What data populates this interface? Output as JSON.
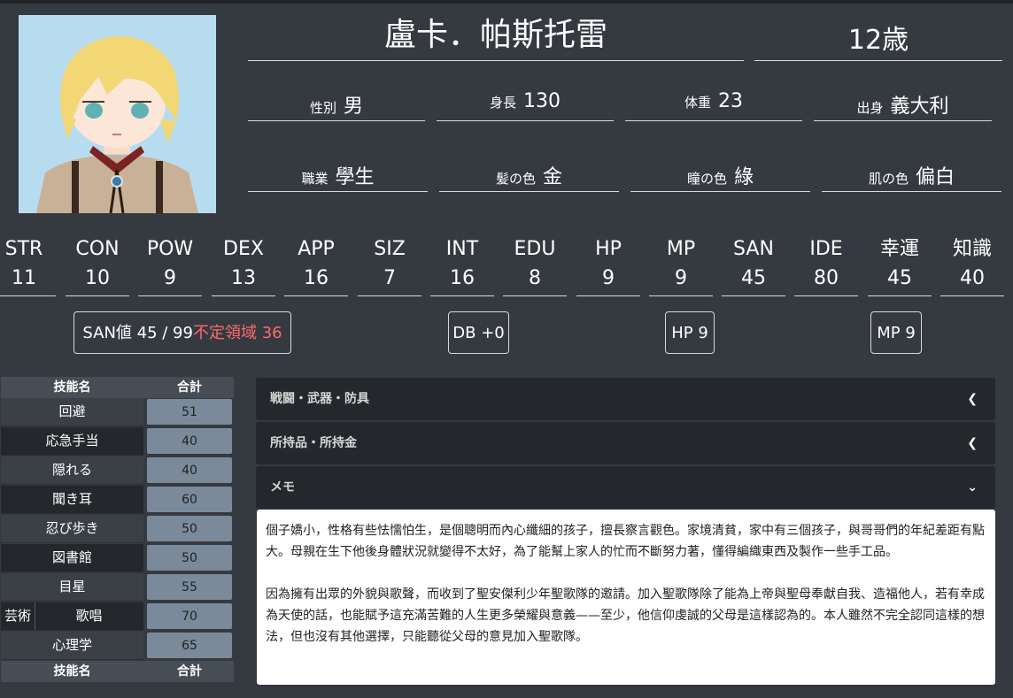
{
  "character": {
    "name": "盧卡．帕斯托雷",
    "age": "12歳"
  },
  "attributes": [
    {
      "label": "性別",
      "value": "男"
    },
    {
      "label": "身長",
      "value": "130"
    },
    {
      "label": "体重",
      "value": "23"
    },
    {
      "label": "出身",
      "value": "義大利"
    },
    {
      "label": "職業",
      "value": "學生"
    },
    {
      "label": "髪の色",
      "value": "金"
    },
    {
      "label": "瞳の色",
      "value": "綠"
    },
    {
      "label": "肌の色",
      "value": "偏白"
    }
  ],
  "stats": [
    {
      "label": "STR",
      "value": "11"
    },
    {
      "label": "CON",
      "value": "10"
    },
    {
      "label": "POW",
      "value": "9"
    },
    {
      "label": "DEX",
      "value": "13"
    },
    {
      "label": "APP",
      "value": "16"
    },
    {
      "label": "SIZ",
      "value": "7"
    },
    {
      "label": "INT",
      "value": "16"
    },
    {
      "label": "EDU",
      "value": "8"
    },
    {
      "label": "HP",
      "value": "9"
    },
    {
      "label": "MP",
      "value": "9"
    },
    {
      "label": "SAN",
      "value": "45"
    },
    {
      "label": "IDE",
      "value": "80"
    },
    {
      "label": "幸運",
      "value": "45"
    },
    {
      "label": "知識",
      "value": "40"
    }
  ],
  "badges": {
    "san": "SAN値 45 / 99",
    "san_warning": "不定領域 36",
    "db": "DB +0",
    "hp": "HP 9",
    "mp": "MP 9"
  },
  "skills": {
    "header_name": "技能名",
    "header_total": "合計",
    "rows": [
      {
        "name": "回避",
        "total": "51"
      },
      {
        "name": "応急手当",
        "total": "40"
      },
      {
        "name": "隠れる",
        "total": "40"
      },
      {
        "name": "聞き耳",
        "total": "60"
      },
      {
        "name": "忍び歩き",
        "total": "50"
      },
      {
        "name": "図書館",
        "total": "50"
      },
      {
        "name": "目星",
        "total": "55"
      },
      {
        "category": "芸術",
        "name": "歌唱",
        "total": "70"
      },
      {
        "name": "心理学",
        "total": "65"
      }
    ]
  },
  "sections": [
    {
      "title": "戦闘・武器・防具",
      "icon": "chevron-left-icon"
    },
    {
      "title": "所持品・所持金",
      "icon": "chevron-left-icon"
    },
    {
      "title": "メモ",
      "icon": "chevron-down-icon"
    }
  ],
  "memo": [
    "個子嬌小，性格有些怯懦怕生，是個聰明而內心纖細的孩子，擅長察言觀色。家境清貧，家中有三個孩子，與哥哥們的年紀差距有點大。母親在生下他後身體狀況就變得不太好，為了能幫上家人的忙而不斷努力著，懂得編織東西及製作一些手工品。",
    "因為擁有出眾的外貌與歌聲，而收到了聖安傑利少年聖歌隊的邀請。加入聖歌隊除了能為上帝與聖母奉獻自我、造福他人，若有幸成為天使的話，也能賦予這充滿苦難的人生更多榮耀與意義——至少，他信仰虔誠的父母是這樣認為的。本人雖然不完全認同這樣的想法，但也沒有其他選擇，只能聽從父母的意見加入聖歌隊。"
  ]
}
